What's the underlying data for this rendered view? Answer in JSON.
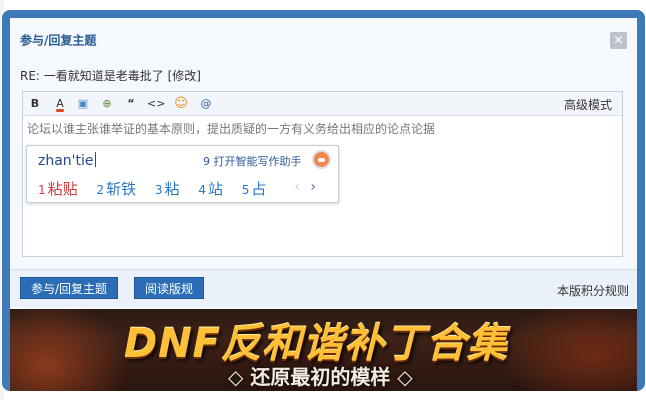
{
  "dialog": {
    "title": "参与/回复主题",
    "close_glyph": "×",
    "re_line": "RE: 一看就知道是老毒批了 [修改]"
  },
  "editor": {
    "toolbar": {
      "bold": "B",
      "font_color": "A",
      "image": "▣",
      "link": "⊕",
      "quote": "“",
      "code": "<>",
      "smiley": "☺",
      "at": "@",
      "advanced": "高级模式"
    },
    "placeholder": "论坛以谁主张谁举证的基本原则，提出质疑的一方有义务给出相应的论点论据"
  },
  "ime": {
    "pinyin": "zhan'tie",
    "assistant": "9 打开智能写作助手",
    "candidates": [
      {
        "num": "1",
        "text": "粘贴"
      },
      {
        "num": "2",
        "text": "斩铁"
      },
      {
        "num": "3",
        "text": "粘"
      },
      {
        "num": "4",
        "text": "站"
      },
      {
        "num": "5",
        "text": "占"
      }
    ],
    "prev": "‹",
    "next": "›"
  },
  "actions": {
    "submit": "参与/回复主题",
    "read_rules": "阅读版规",
    "score_rules": "本版积分规则"
  },
  "banner": {
    "title": "DNF反和谐补丁合集",
    "subtitle": "◇ 还原最初的模样 ◇"
  },
  "colors": {
    "frame": "#3e7ab8",
    "button": "#2a6db6",
    "title": "#2a5c93",
    "first_candidate": "#d43b3b",
    "candidate": "#2a78c5"
  }
}
